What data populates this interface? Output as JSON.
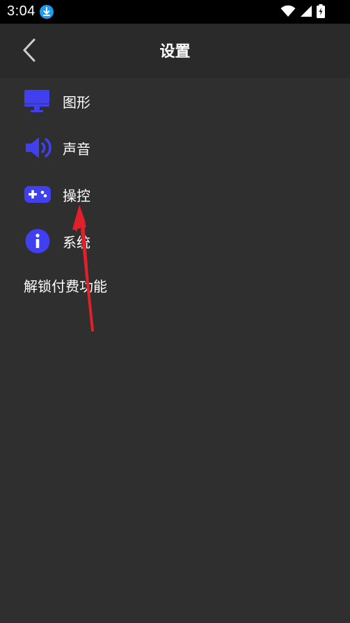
{
  "status_bar": {
    "time": "3:04",
    "icons": [
      "download-icon",
      "wifi-icon",
      "signal-icon",
      "battery-icon"
    ]
  },
  "header": {
    "title": "设置",
    "back_icon": "chevron-left-icon"
  },
  "menu": {
    "items": [
      {
        "label": "图形",
        "icon": "monitor-icon"
      },
      {
        "label": "声音",
        "icon": "speaker-icon"
      },
      {
        "label": "操控",
        "icon": "gamepad-icon"
      },
      {
        "label": "系统",
        "icon": "info-icon"
      }
    ],
    "unlock_label": "解锁付费功能"
  },
  "colors": {
    "background": "#2f2f2f",
    "header": "#2a2a2a",
    "statusbar": "#000000",
    "accent_icon": "#4040f0",
    "download_badge": "#1e9bf0",
    "annotation_arrow": "#e0202a"
  }
}
